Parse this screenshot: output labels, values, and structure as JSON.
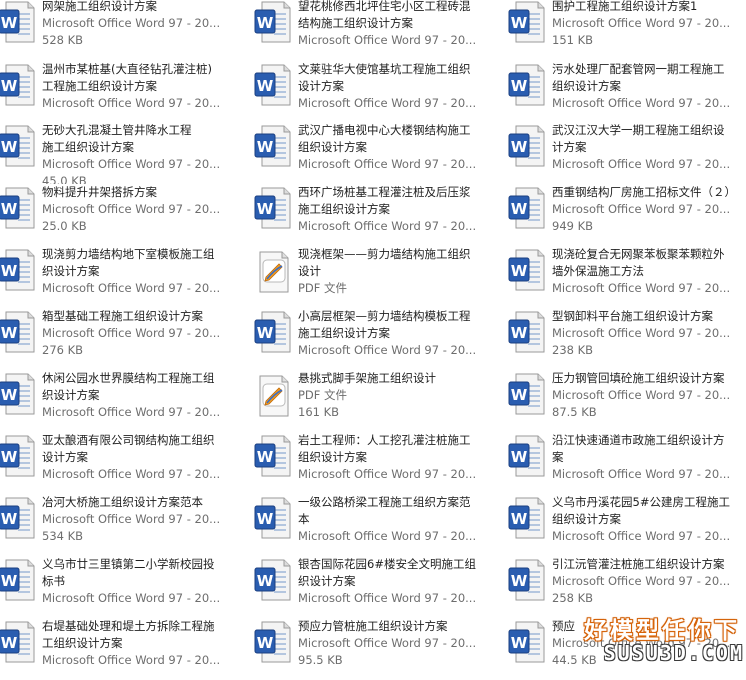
{
  "columns": [
    {
      "items": [
        {
          "type": "word",
          "name_lines": [
            "网架施工组织设计方案"
          ],
          "kind": "Microsoft Office Word 97 - 20...",
          "size": "528 KB"
        },
        {
          "type": "word",
          "name_lines": [
            "温州市某桩基(大直径钻孔灌注桩)",
            "工程施工组织设计方案"
          ],
          "kind": "Microsoft Office Word 97 - 20...",
          "size": ""
        },
        {
          "type": "word",
          "name_lines": [
            "无砂大孔混凝土管井降水工程",
            "施工组织设计方案"
          ],
          "kind": "Microsoft Office Word 97 - 20...",
          "size": "45.0 KB"
        },
        {
          "type": "word",
          "name_lines": [
            "物料提升井架搭拆方案"
          ],
          "kind": "Microsoft Office Word 97 - 20...",
          "size": "25.0 KB"
        },
        {
          "type": "word",
          "name_lines": [
            "现浇剪力墙结构地下室模板施工组",
            "织设计方案"
          ],
          "kind": "Microsoft Office Word 97 - 20...",
          "size": ""
        },
        {
          "type": "word",
          "name_lines": [
            "箱型基础工程施工组织设计方案"
          ],
          "kind": "Microsoft Office Word 97 - 20...",
          "size": "276 KB"
        },
        {
          "type": "word",
          "name_lines": [
            "休闲公园水世界膜结构工程施工组",
            "织设计方案"
          ],
          "kind": "Microsoft Office Word 97 - 20...",
          "size": ""
        },
        {
          "type": "word",
          "name_lines": [
            "亚太酿酒有限公司钢结构施工组织",
            "设计方案"
          ],
          "kind": "Microsoft Office Word 97 - 20...",
          "size": ""
        },
        {
          "type": "word",
          "name_lines": [
            "冶河大桥施工组织设计方案范本"
          ],
          "kind": "Microsoft Office Word 97 - 20...",
          "size": "534 KB"
        },
        {
          "type": "word",
          "name_lines": [
            "义乌市廿三里镇第二小学新校园投",
            "标书"
          ],
          "kind": "Microsoft Office Word 97 - 20...",
          "size": ""
        },
        {
          "type": "word",
          "name_lines": [
            "右堤基础处理和堤土方拆除工程施",
            "工组织设计方案"
          ],
          "kind": "Microsoft Office Word 97 - 20...",
          "size": ""
        }
      ]
    },
    {
      "items": [
        {
          "type": "word",
          "name_lines": [
            "望花桃修西北坪住宅小区工程砖混",
            "结构施工组织设计方案"
          ],
          "kind": "Microsoft Office Word 97 - 20...",
          "size": ""
        },
        {
          "type": "word",
          "name_lines": [
            "文莱驻华大使馆基坑工程施工组织",
            "设计方案"
          ],
          "kind": "Microsoft Office Word 97 - 20...",
          "size": ""
        },
        {
          "type": "word",
          "name_lines": [
            "武汉广播电视中心大楼钢结构施工",
            "组织设计方案"
          ],
          "kind": "Microsoft Office Word 97 - 20...",
          "size": ""
        },
        {
          "type": "word",
          "name_lines": [
            "西环广场桩基工程灌注桩及后压浆",
            "施工组织设计方案"
          ],
          "kind": "Microsoft Office Word 97 - 20...",
          "size": ""
        },
        {
          "type": "pdf",
          "name_lines": [
            "现浇框架——剪力墙结构施工组织",
            "设计"
          ],
          "kind": "PDF 文件",
          "size": ""
        },
        {
          "type": "word",
          "name_lines": [
            "小高层框架—剪力墙结构模板工程",
            "施工组织设计方案"
          ],
          "kind": "Microsoft Office Word 97 - 20...",
          "size": ""
        },
        {
          "type": "pdf",
          "name_lines": [
            "悬挑式脚手架施工组织设计"
          ],
          "kind": "PDF 文件",
          "size": "161 KB"
        },
        {
          "type": "word",
          "name_lines": [
            "岩土工程师：人工挖孔灌注桩施工",
            "组织设计方案"
          ],
          "kind": "Microsoft Office Word 97 - 20...",
          "size": ""
        },
        {
          "type": "word",
          "name_lines": [
            "一级公路桥梁工程施工组织方案范",
            "本"
          ],
          "kind": "Microsoft Office Word 97 - 20...",
          "size": ""
        },
        {
          "type": "word",
          "name_lines": [
            "银杏国际花园6#楼安全文明施工组",
            "织设计方案"
          ],
          "kind": "Microsoft Office Word 97 - 20...",
          "size": ""
        },
        {
          "type": "word",
          "name_lines": [
            "预应力管桩施工组织设计方案"
          ],
          "kind": "Microsoft Office Word 97 - 20...",
          "size": "95.5 KB"
        }
      ]
    },
    {
      "items": [
        {
          "type": "word",
          "name_lines": [
            "围护工程施工组织设计方案1"
          ],
          "kind": "Microsoft Office Word 97 - 20...",
          "size": "151 KB"
        },
        {
          "type": "word",
          "name_lines": [
            "污水处理厂配套管网一期工程施工",
            "组织设计方案"
          ],
          "kind": "Microsoft Office Word 97 - 20...",
          "size": ""
        },
        {
          "type": "word",
          "name_lines": [
            "武汉江汉大学一期工程施工组织设",
            "计方案"
          ],
          "kind": "Microsoft Office Word 97 - 20...",
          "size": ""
        },
        {
          "type": "word",
          "name_lines": [
            "西重钢结构厂房施工招标文件（２）"
          ],
          "kind": "Microsoft Office Word 97 - 20...",
          "size": "949 KB"
        },
        {
          "type": "word",
          "name_lines": [
            "现浇砼复合无网聚苯板聚苯颗粒外",
            "墙外保温施工方法"
          ],
          "kind": "Microsoft Office Word 97 - 20...",
          "size": ""
        },
        {
          "type": "word",
          "name_lines": [
            "型钢卸料平台施工组织设计方案"
          ],
          "kind": "Microsoft Office Word 97 - 20...",
          "size": "238 KB"
        },
        {
          "type": "word",
          "name_lines": [
            "压力钢管回填砼施工组织设计方案"
          ],
          "kind": "Microsoft Office Word 97 - 20...",
          "size": "87.5 KB"
        },
        {
          "type": "word",
          "name_lines": [
            "沿江快速通道市政施工组织设计方",
            "案"
          ],
          "kind": "Microsoft Office Word 97 - 20...",
          "size": ""
        },
        {
          "type": "word",
          "name_lines": [
            "义乌市丹溪花园5#公建房工程施工",
            "组织设计方案"
          ],
          "kind": "Microsoft Office Word 97 - 20...",
          "size": ""
        },
        {
          "type": "word",
          "name_lines": [
            "引江沅管灌注桩施工组织设计方案"
          ],
          "kind": "Microsoft Office Word 97 - 20...",
          "size": "258 KB"
        },
        {
          "type": "word",
          "name_lines": [
            "预应"
          ],
          "kind": "Microsoft Office Word 97 - 20...",
          "size": "44.5 KB"
        }
      ]
    }
  ],
  "watermark": {
    "line1": "好模型任你下",
    "line2": "SUSU3D.COM"
  },
  "colors": {
    "word_blue": "#2a5db0",
    "text": "#1e1e1e",
    "meta_text": "#6d6d6d",
    "watermark_orange": "#e06a10"
  }
}
